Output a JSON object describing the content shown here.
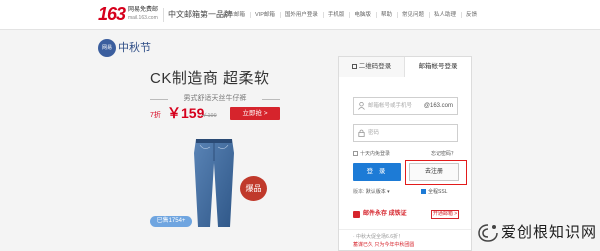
{
  "header": {
    "logo_number": "163",
    "logo_name": "网易免费邮",
    "logo_domain": "mail.163.com",
    "slogan": "中文邮箱第一品牌",
    "nav": [
      "企业邮箱",
      "VIP邮箱",
      "国外用户登录",
      "手机版",
      "电脑版",
      "帮助",
      "常见问题",
      "私人助理",
      "反馈"
    ]
  },
  "promo": {
    "festival_badge": "网易",
    "festival_text": "中秋节",
    "title": "CK制造商 超柔软",
    "subtitle": "男式舒适天丝牛仔裤",
    "discount": "7折",
    "price": "￥159",
    "old_price": "￥199",
    "buy_label": "立即抢 >",
    "hot_badge": "爆品",
    "sold_count": "已售1754+"
  },
  "login": {
    "tab_qr": "二维码登录",
    "tab_mail": "邮箱帐号登录",
    "username_placeholder": "邮箱帐号或手机号",
    "username_suffix": "@163.com",
    "password_placeholder": "密码",
    "remember_label": "十天内免登录",
    "forgot_label": "忘记密码？",
    "login_button": "登 录",
    "register_button": "去注册",
    "version_label": "版本:",
    "version_value": "默认版本 ▾",
    "ssl_label": "全程SSL",
    "promo_text": "邮件永存 成铁证",
    "promo_button": "开通邮箱 >",
    "notice_line1": "· 中秋大促全场6.6折！",
    "notice_line2": "蓄谋已久 只为今年中秋团圆"
  },
  "watermark": {
    "text": "爱创根知识网"
  },
  "colors": {
    "brand_red": "#d6001c",
    "login_blue": "#1d7bd6",
    "highlight_red": "#e21b1b"
  }
}
